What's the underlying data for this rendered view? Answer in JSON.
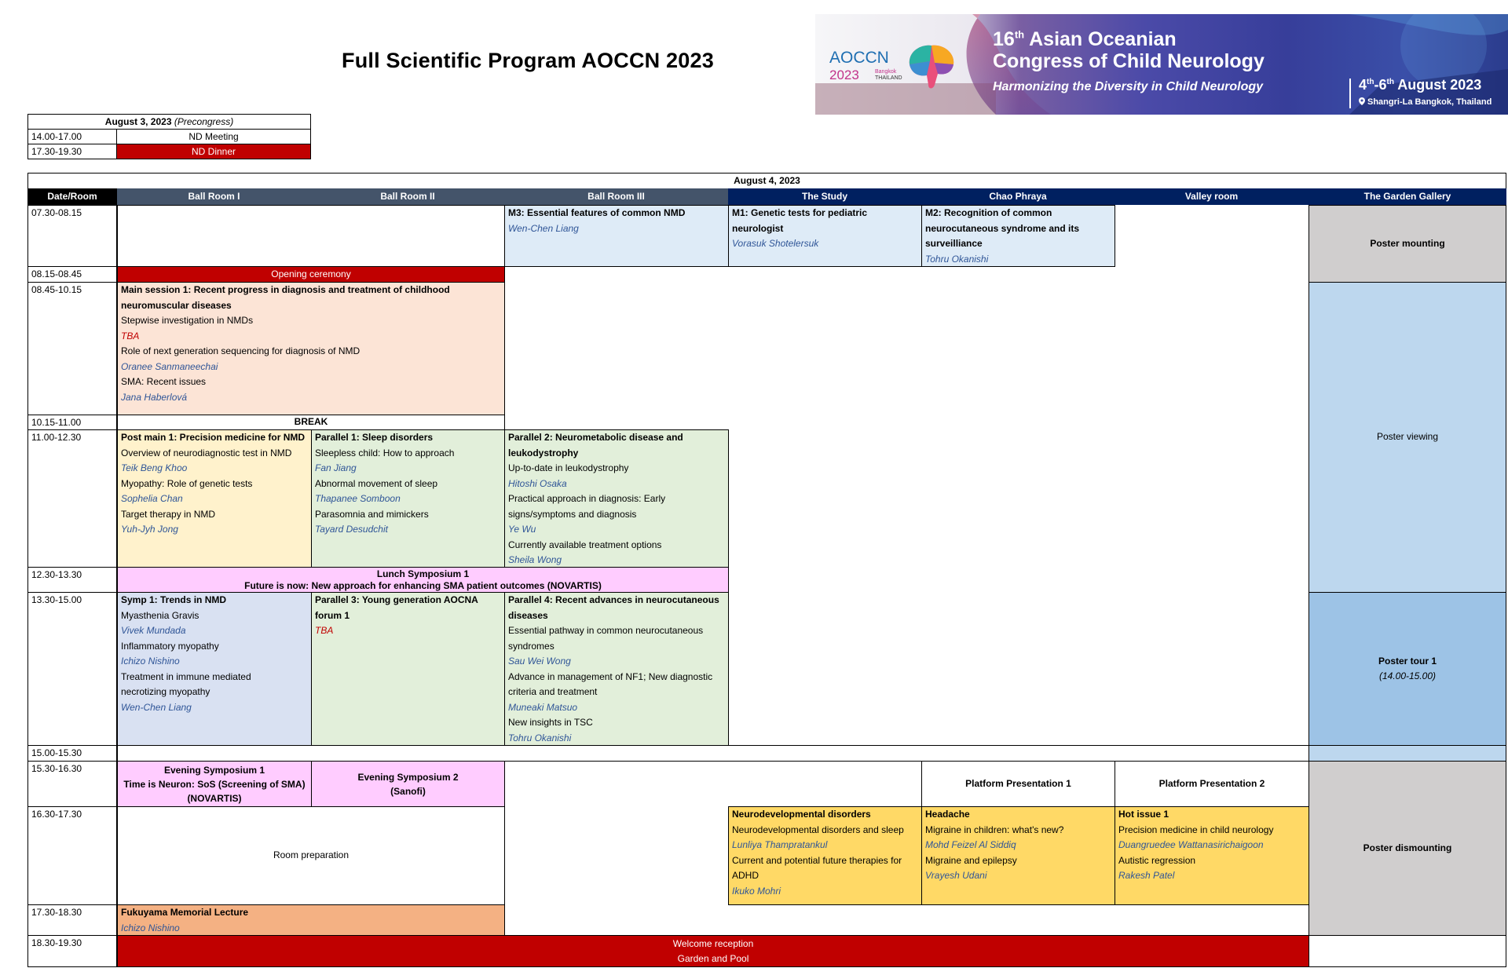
{
  "title": "Full Scientific Program AOCCN 2023",
  "banner": {
    "logo_text": "AOCCN",
    "logo_year": "2023",
    "logo_city": "Bangkok",
    "logo_country": "THAILAND",
    "line1_num": "16",
    "line1_sup": "th",
    "line1_rest": " Asian Oceanian",
    "line2": "Congress of Child Neurology",
    "line3": "Harmonizing the Diversity in Child Neurology",
    "date_start": "4",
    "date_start_sup": "th",
    "date_dash": "-6",
    "date_end_sup": "th",
    "date_rest": " August 2023",
    "venue": "Shangri-La Bangkok, Thailand"
  },
  "precongress": {
    "header_date": "August 3, 2023",
    "header_note": "(Precongress)",
    "rows": [
      {
        "time": "14.00-17.00",
        "event": "ND Meeting"
      },
      {
        "time": "17.30-19.30",
        "event": "ND Dinner"
      }
    ]
  },
  "main": {
    "date": "August 4, 2023",
    "headers": [
      "Date/Room",
      "Ball Room I",
      "Ball Room II",
      "Ball Room  III",
      "The Study",
      "Chao Phraya",
      "Valley room",
      "The Garden Gallery"
    ],
    "times": [
      "07.30-08.15",
      "08.15-08.45",
      "08.45-10.15",
      "10.15-11.00",
      "11.00-12.30",
      "12.30-13.30",
      "13.30-15.00",
      "15.00-15.30",
      "15.30-16.30",
      "16.30-17.30",
      "17.30-18.30",
      "18.30-19.30"
    ],
    "m3": {
      "title": "M3: Essential features of common NMD",
      "speaker": "Wen-Chen Liang"
    },
    "m1": {
      "title": "M1: Genetic tests for pediatric neurologist",
      "speaker": "Vorasuk Shotelersuk"
    },
    "m2": {
      "title_1": "M2: Recognition of common",
      "title_2": "neurocutaneous syndrome and its",
      "title_3": "surveilliance",
      "speaker": "Tohru Okanishi"
    },
    "poster_mounting": "Poster mounting",
    "opening": "Opening ceremony",
    "main1": {
      "title_1": "Main session 1: Recent progress in diagnosis and treatment of childhood",
      "title_2": "neuromuscular diseases",
      "t1": "Stepwise investigation in NMDs",
      "s1": "TBA",
      "t2": "Role of next generation sequencing for diagnosis of NMD",
      "s2": "Oranee Sanmaneechai",
      "t3": "SMA: Recent issues",
      "s3": "Jana Haberlová"
    },
    "poster_viewing": "Poster viewing",
    "break": "BREAK",
    "postmain1": {
      "title": "Post main 1: Precision medicine for NMD",
      "t1": "Overview of neurodiagnostic test in NMD",
      "s1": "Teik Beng Khoo",
      "t2": "Myopathy: Role of genetic tests",
      "s2": "Sophelia Chan",
      "t3": "Target therapy in NMD",
      "s3": "Yuh-Jyh Jong"
    },
    "parallel1": {
      "title": "Parallel 1: Sleep disorders",
      "t1": "Sleepless child: How to approach",
      "s1": "Fan Jiang",
      "t2": "Abnormal movement of sleep",
      "s2": "Thapanee Somboon",
      "t3": "Parasomnia and mimickers",
      "s3": "Tayard Desudchit"
    },
    "parallel2": {
      "title_1": "Parallel 2: Neurometabolic disease and",
      "title_2": "leukodystrophy",
      "t1": "Up-to-date in leukodystrophy",
      "s1": "Hitoshi Osaka",
      "t2a": "Practical approach in diagnosis: Early",
      "t2b": "signs/symptoms and diagnosis",
      "s2": "Ye Wu",
      "t3": "Currently available treatment options",
      "s3": "Sheila Wong"
    },
    "lunch": {
      "title": "Lunch Symposium 1",
      "subtitle": "Future is now: New approach for enhancing SMA patient outcomes (NOVARTIS)"
    },
    "symp1": {
      "title": "Symp 1: Trends in NMD",
      "t1": "Myasthenia Gravis",
      "s1": "Vivek Mundada",
      "t2": "Inflammatory myopathy",
      "s2": "Ichizo Nishino",
      "t3a": "Treatment in immune mediated",
      "t3b": "necrotizing myopathy",
      "s3": "Wen-Chen Liang"
    },
    "parallel3": {
      "title_1": "Parallel 3: Young generation AOCNA",
      "title_2": "forum 1",
      "s1": "TBA"
    },
    "parallel4": {
      "title_1": "Parallel 4: Recent advances in neurocutaneous",
      "title_2": "diseases",
      "t1a": "Essential pathway in common neurocutaneous",
      "t1b": "syndromes",
      "s1": "Sau Wei Wong",
      "t2a": "Advance in management of NF1; New diagnostic",
      "t2b": "criteria and treatment",
      "s2": "Muneaki Matsuo",
      "t3": "New insights in TSC",
      "s3": "Tohru Okanishi"
    },
    "poster_tour": {
      "title": "Poster tour 1",
      "time": "(14.00-15.00)"
    },
    "evening1": {
      "title": "Evening Symposium 1",
      "line2": "Time is Neuron: SoS (Screening of SMA)",
      "line3": "(NOVARTIS)"
    },
    "evening2": {
      "title": "Evening Symposium 2",
      "line2": "(Sanofi)"
    },
    "platform1": "Platform Presentation 1",
    "platform2": "Platform Presentation 2",
    "room_prep": "Room preparation",
    "neurodev": {
      "title": "Neurodevelopmental disorders",
      "t1": "Neurodevelopmental disorders and sleep",
      "s1": "Lunliya Thampratankul",
      "t2a": "Current and potential future therapies for",
      "t2b": "ADHD",
      "s2": "Ikuko Mohri"
    },
    "headache": {
      "title": "Headache",
      "t1": "Migraine in children: what's new?",
      "s1": "Mohd Feizel Al Siddiq",
      "t2": "Migraine and epilepsy",
      "s2": "Vrayesh Udani"
    },
    "hotissue": {
      "title": "Hot issue 1",
      "t1": "Precision medicine in child neurology",
      "s1": "Duangruedee Wattanasirichaigoon",
      "t2": "Autistic regression",
      "s2": "Rakesh Patel"
    },
    "poster_dismounting": "Poster dismounting",
    "fukuyama": {
      "title": "Fukuyama Memorial Lecture",
      "speaker": "Ichizo Nishino"
    },
    "welcome": {
      "title": "Welcome reception",
      "subtitle": "Garden and Pool"
    }
  },
  "colors": {
    "header_gray": "#44546a",
    "header_navy": "#002060",
    "red": "#c00000",
    "light_blue": "#deebf7",
    "peach": "#fce4d6",
    "cream": "#fff2cc",
    "green": "#e2efda",
    "pink": "#ffccff",
    "lavender": "#d9e1f2",
    "gold": "#ffd966",
    "salmon": "#f4b183",
    "poster_blue": "#bdd7ee",
    "poster_tour_blue": "#9dc3e6",
    "gray": "#d0cece"
  }
}
